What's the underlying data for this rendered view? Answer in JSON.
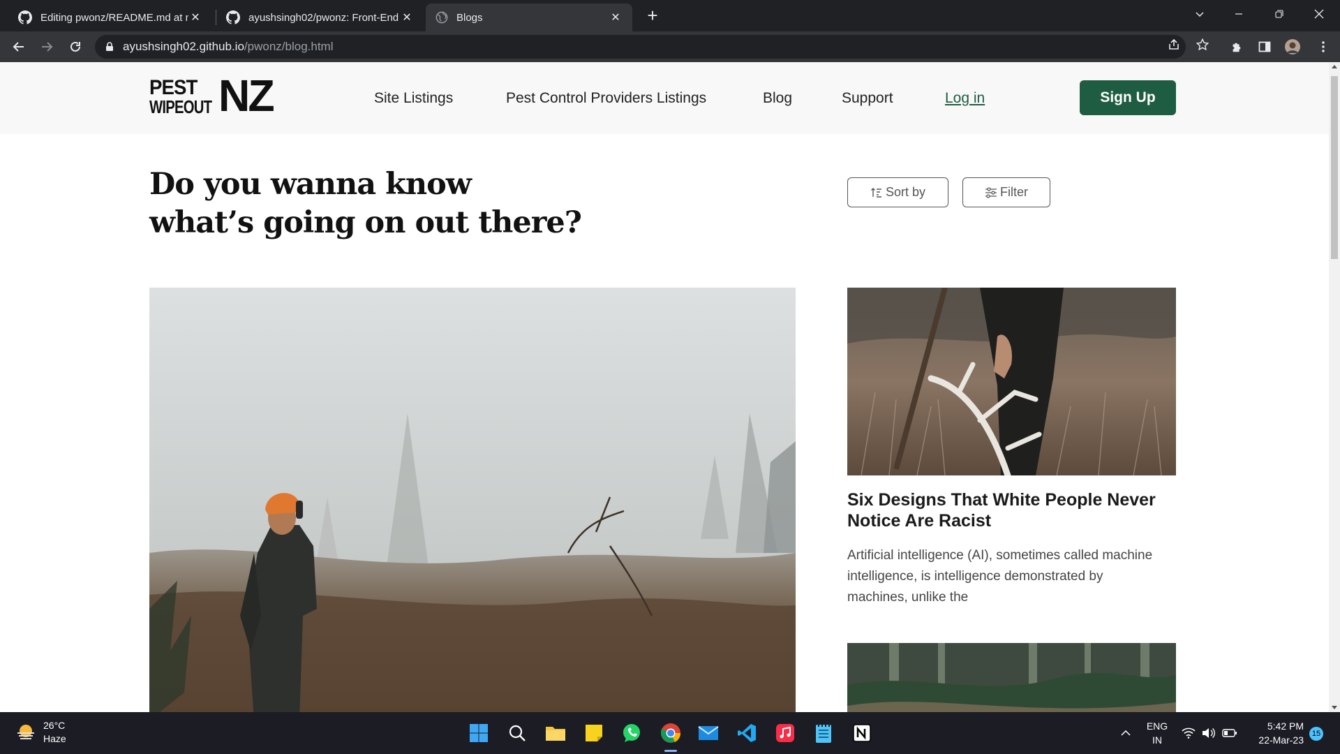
{
  "browser": {
    "tabs": [
      {
        "title": "Editing pwonz/README.md at m",
        "icon": "github-icon",
        "active": false
      },
      {
        "title": "ayushsingh02/pwonz: Front-End",
        "icon": "github-icon",
        "active": false
      },
      {
        "title": "Blogs",
        "icon": "globe-icon",
        "active": true
      }
    ],
    "url_host": "ayushsingh02.github.io",
    "url_path": "/pwonz/blog.html"
  },
  "site": {
    "logo": {
      "line1": "PEST",
      "line2": "WIPEOUT",
      "big": "NZ"
    },
    "nav": {
      "site_listings": "Site Listings",
      "providers": "Pest Control Providers Listings",
      "blog": "Blog",
      "support": "Support",
      "login": "Log in",
      "signup": "Sign Up"
    },
    "hero_title": "Do you wanna know what’s going on out there?",
    "sort_label": "Sort by",
    "filter_label": "Filter",
    "posts": [
      {
        "title": "Six Designs That White People Never Notice Are Racist",
        "excerpt": "Artificial intelligence (AI), sometimes called machine intelligence, is intelligence demonstrated by machines, unlike the"
      }
    ],
    "accent_color": "#1f5d43"
  },
  "taskbar": {
    "weather_temp": "26°C",
    "weather_desc": "Haze",
    "lang_top": "ENG",
    "lang_bottom": "IN",
    "time": "5:42 PM",
    "date": "22-Mar-23",
    "notifications": "15"
  }
}
